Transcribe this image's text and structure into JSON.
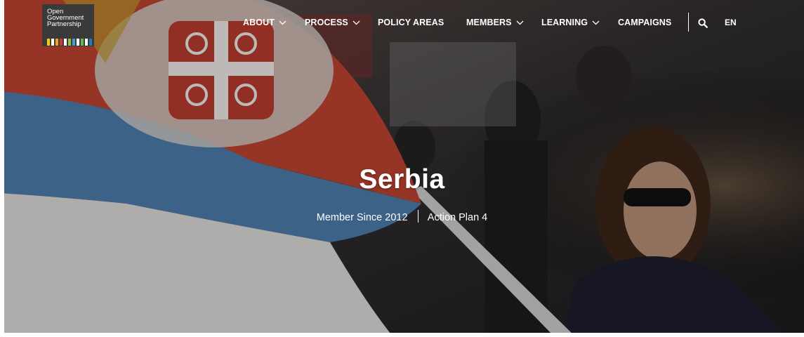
{
  "logo": {
    "line1": "Open",
    "line2": "Government",
    "line3": "Partnership"
  },
  "nav": {
    "items": [
      {
        "label": "ABOUT",
        "has_dropdown": true
      },
      {
        "label": "PROCESS",
        "has_dropdown": true
      },
      {
        "label": "POLICY AREAS",
        "has_dropdown": false
      },
      {
        "label": "MEMBERS",
        "has_dropdown": true
      },
      {
        "label": "LEARNING",
        "has_dropdown": true
      },
      {
        "label": "CAMPAIGNS",
        "has_dropdown": false
      }
    ],
    "search_icon": "search-icon",
    "language": "EN"
  },
  "hero": {
    "title": "Serbia",
    "member_since": "Member Since 2012",
    "action_plan": "Action Plan 4"
  },
  "colors": {
    "flag_red": "#b8402e",
    "flag_blue": "#4a78a6",
    "flag_white": "#dcdcdc",
    "text": "#ffffff"
  }
}
